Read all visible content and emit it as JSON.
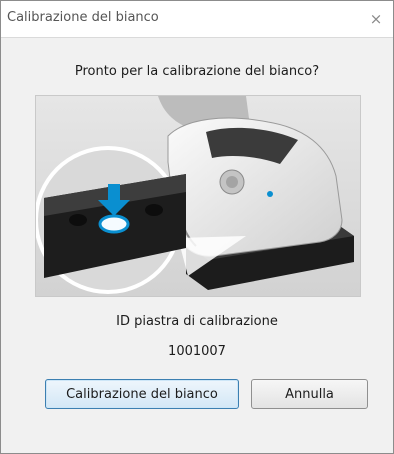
{
  "dialog": {
    "title": "Calibrazione del bianco",
    "close_glyph": "×",
    "prompt": "Pronto per la calibrazione del bianco?",
    "illustration": {
      "subject": "spectrophotometer on white calibration plate",
      "accent_color": "#0a8fd0"
    },
    "plate_id_label": "ID piastra di calibrazione",
    "plate_id_value": "1001007",
    "buttons": {
      "calibrate_label": "Calibrazione del bianco",
      "cancel_label": "Annulla"
    }
  }
}
